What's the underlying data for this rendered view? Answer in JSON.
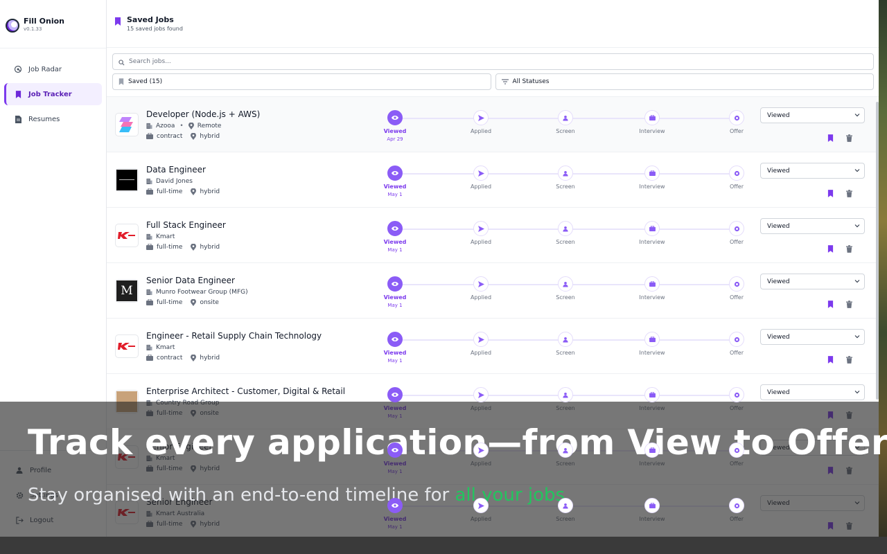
{
  "app": {
    "name": "Fill Onion",
    "version": "v0.1.33"
  },
  "nav": [
    {
      "label": "Job Radar",
      "icon": "radar-icon",
      "active": false
    },
    {
      "label": "Job Tracker",
      "icon": "bookmark-icon",
      "active": true
    },
    {
      "label": "Resumes",
      "icon": "document-icon",
      "active": false
    }
  ],
  "nav_bottom": [
    {
      "label": "Profile",
      "icon": "user-icon"
    },
    {
      "label": "Settings",
      "icon": "gear-icon"
    },
    {
      "label": "Logout",
      "icon": "logout-icon"
    }
  ],
  "header": {
    "title": "Saved Jobs",
    "subtitle": "15 saved jobs found"
  },
  "search": {
    "placeholder": "Search jobs..."
  },
  "filters": {
    "saved": "Saved (15)",
    "status": "All Statuses"
  },
  "stages": [
    "Viewed",
    "Applied",
    "Screen",
    "Interview",
    "Offer"
  ],
  "jobs": [
    {
      "title": "Developer (Node.js + AWS)",
      "company": "Azooa",
      "location": "Remote",
      "type": "contract",
      "mode": "hybrid",
      "date": "Apr 29",
      "status": "Viewed",
      "logo": "azooa"
    },
    {
      "title": "Data Engineer",
      "company": "David Jones",
      "location": "",
      "type": "full-time",
      "mode": "hybrid",
      "date": "May 1",
      "status": "Viewed",
      "logo": "davidjones"
    },
    {
      "title": "Full Stack Engineer",
      "company": "Kmart",
      "location": "",
      "type": "full-time",
      "mode": "hybrid",
      "date": "May 1",
      "status": "Viewed",
      "logo": "kmart"
    },
    {
      "title": "Senior Data Engineer",
      "company": "Munro Footwear Group (MFG)",
      "location": "",
      "type": "full-time",
      "mode": "onsite",
      "date": "May 1",
      "status": "Viewed",
      "logo": "munro"
    },
    {
      "title": "Engineer - Retail Supply Chain Technology",
      "company": "Kmart",
      "location": "",
      "type": "contract",
      "mode": "hybrid",
      "date": "May 1",
      "status": "Viewed",
      "logo": "kmart"
    },
    {
      "title": "Enterprise Architect - Customer, Digital & Retail",
      "company": "Country Road Group",
      "location": "",
      "type": "full-time",
      "mode": "onsite",
      "date": "May 1",
      "status": "Viewed",
      "logo": "countryroad"
    },
    {
      "title": "Senior Engineer",
      "company": "Kmart",
      "location": "",
      "type": "full-time",
      "mode": "hybrid",
      "date": "May 1",
      "status": "Viewed",
      "logo": "kmart"
    },
    {
      "title": "Senior Engineer",
      "company": "Kmart Australia",
      "location": "",
      "type": "full-time",
      "mode": "hybrid",
      "date": "May 1",
      "status": "Viewed",
      "logo": "kmart"
    }
  ],
  "overlay": {
    "title": "Track every application—from View to Offer",
    "subtitle_prefix": "Stay organised with an end-to-end timeline for ",
    "subtitle_highlight": "all your jobs"
  },
  "colors": {
    "accent": "#7c3aed",
    "accent_light": "#8b5cf6",
    "highlight": "#22c55e"
  }
}
